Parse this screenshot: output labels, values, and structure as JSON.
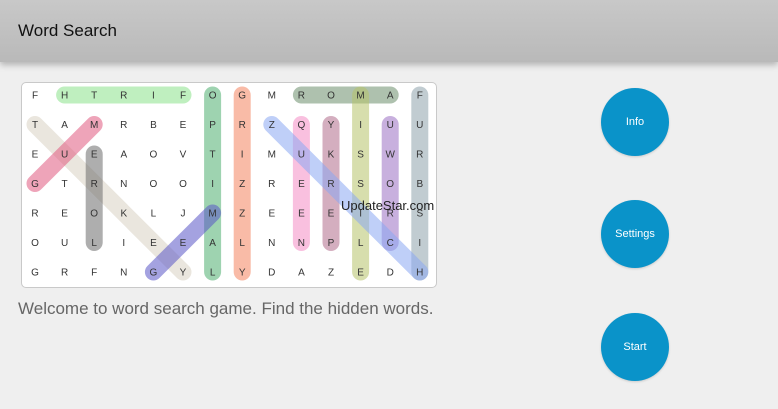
{
  "appbar": {
    "title": "Word Search"
  },
  "grid": {
    "rows": [
      [
        "F",
        "H",
        "T",
        "R",
        "I",
        "F",
        "O",
        "G",
        "M",
        "R",
        "O",
        "M",
        "A",
        "F"
      ],
      [
        "T",
        "A",
        "M",
        "R",
        "B",
        "E",
        "P",
        "R",
        "Z",
        "Q",
        "Y",
        "I",
        "U",
        "U"
      ],
      [
        "E",
        "U",
        "E",
        "A",
        "O",
        "V",
        "T",
        "I",
        "M",
        "U",
        "K",
        "S",
        "W",
        "R"
      ],
      [
        "G",
        "T",
        "R",
        "N",
        "O",
        "O",
        "I",
        "Z",
        "R",
        "E",
        "R",
        "S",
        "O",
        "B"
      ],
      [
        "R",
        "E",
        "O",
        "K",
        "L",
        "J",
        "M",
        "Z",
        "E",
        "E",
        "E",
        "I",
        "R",
        "S"
      ],
      [
        "O",
        "U",
        "L",
        "I",
        "E",
        "E",
        "A",
        "L",
        "N",
        "N",
        "P",
        "L",
        "C",
        "I"
      ],
      [
        "G",
        "R",
        "F",
        "N",
        "G",
        "Y",
        "L",
        "Y",
        "D",
        "A",
        "Z",
        "E",
        "D",
        "H"
      ]
    ],
    "found_words": [
      {
        "color": "#8be28b",
        "start": [
          0,
          1
        ],
        "end": [
          0,
          5
        ]
      },
      {
        "color": "#6b8e6b",
        "start": [
          0,
          9
        ],
        "end": [
          0,
          12
        ]
      },
      {
        "color": "#4fae6f",
        "start": [
          0,
          6
        ],
        "end": [
          6,
          6
        ]
      },
      {
        "color": "#f4845f",
        "start": [
          0,
          7
        ],
        "end": [
          6,
          7
        ]
      },
      {
        "color": "#8ea2ac",
        "start": [
          0,
          13
        ],
        "end": [
          6,
          13
        ]
      },
      {
        "color": "#b7c26a",
        "start": [
          0,
          11
        ],
        "end": [
          6,
          11
        ]
      },
      {
        "color": "#d8d2c2",
        "start": [
          1,
          0
        ],
        "end": [
          6,
          5
        ]
      },
      {
        "color": "#e05a7f",
        "start": [
          1,
          2
        ],
        "end": [
          3,
          0
        ]
      },
      {
        "color": "#f48cc4",
        "start": [
          1,
          9
        ],
        "end": [
          5,
          9
        ]
      },
      {
        "color": "#b06b8a",
        "start": [
          1,
          10
        ],
        "end": [
          5,
          10
        ]
      },
      {
        "color": "#9b6fc2",
        "start": [
          1,
          12
        ],
        "end": [
          5,
          12
        ]
      },
      {
        "color": "#8aa8f2",
        "start": [
          1,
          8
        ],
        "end": [
          6,
          13
        ]
      },
      {
        "color": "#6b6b6b",
        "start": [
          2,
          2
        ],
        "end": [
          5,
          2
        ]
      },
      {
        "color": "#5a55c7",
        "start": [
          4,
          6
        ],
        "end": [
          6,
          4
        ]
      }
    ]
  },
  "watermark": "UpdateStar.com",
  "welcome_text": "Welcome to word search game. Find the hidden words.",
  "buttons": {
    "info": "Info",
    "settings": "Settings",
    "start": "Start"
  }
}
